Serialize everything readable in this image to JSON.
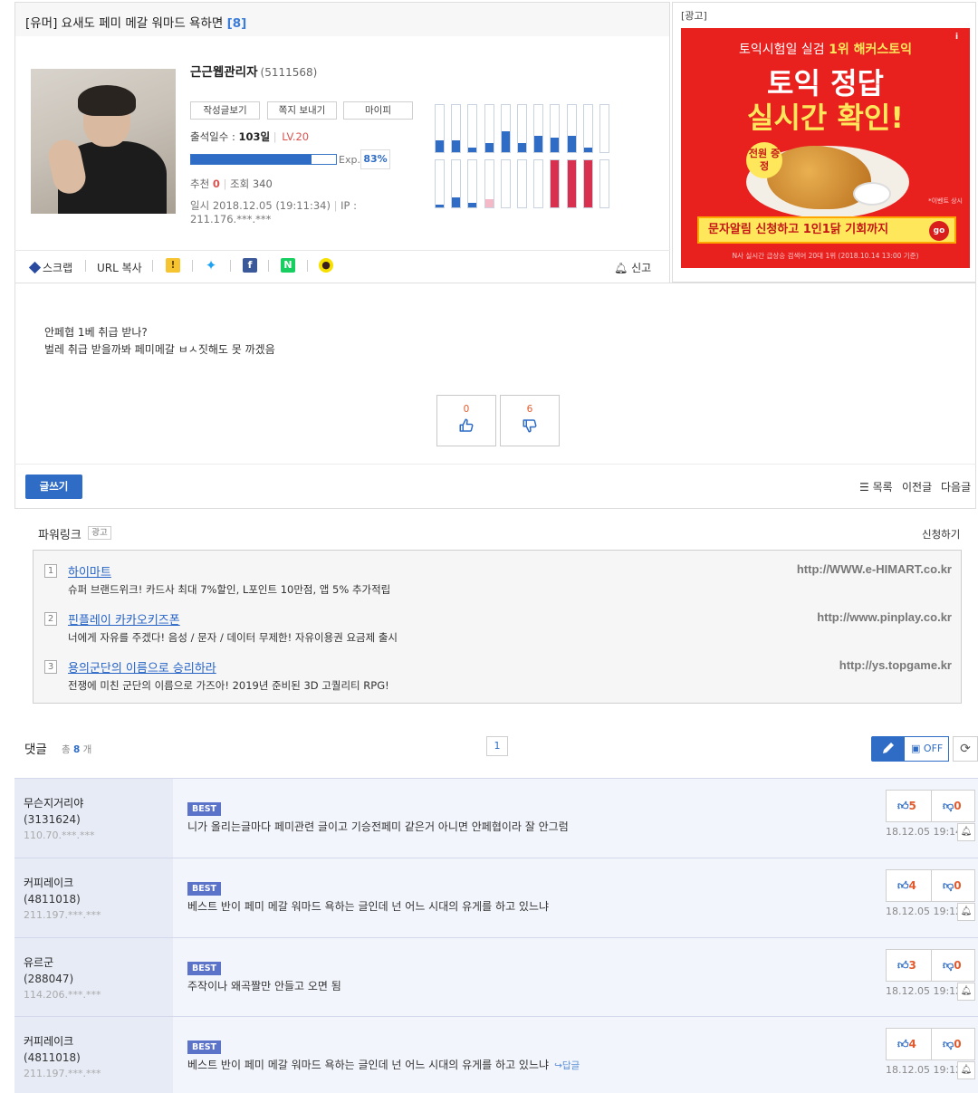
{
  "post": {
    "title": "[유머] 요새도 페미 메갈 워마드 욕하면 ",
    "comment_count_label": "[8]",
    "body_lines": [
      "안페협 1베 취급 받나?",
      "벌레 취급 받을까봐 페미메갈 ㅂㅅ짓해도 못 까겠음"
    ],
    "votes": {
      "up": "0",
      "down": "6"
    }
  },
  "author": {
    "name": "근근웹관리자",
    "id": "(5111568)",
    "buttons": [
      "작성글보기",
      "쪽지 보내기",
      "마이피"
    ],
    "attendance_label": "출석일수 : ",
    "attendance_days": "103일",
    "level": "LV.20",
    "exp_label": "Exp.",
    "exp_percent": "83%",
    "exp_value": 0.83,
    "rec_label": "추천",
    "rec_count": "0",
    "views_label": "조회 340",
    "date_line": "일시 2018.12.05 (19:11:34)",
    "ip_line": "IP : 211.176.***.***",
    "activity_top": [
      0.25,
      0.25,
      0.1,
      0.2,
      0.45,
      0.2,
      0.35,
      0.3,
      0.35,
      0.1,
      0.0
    ],
    "activity_bottom": [
      0.05,
      0.22,
      0.1,
      0.18,
      0.0,
      0.0,
      0.0,
      1.0,
      1.0,
      1.0,
      0.0
    ],
    "activity_bottom_colors": [
      "#2e6cc6",
      "#2e6cc6",
      "#2e6cc6",
      "#f4b8c6",
      "#2e6cc6",
      "#2e6cc6",
      "#2e6cc6",
      "#d9304f",
      "#d9304f",
      "#d9304f",
      "#2e6cc6"
    ]
  },
  "share": {
    "scrap": "스크랩",
    "url_copy": "URL 복사",
    "report": "신고"
  },
  "ad": {
    "label": "[광고]",
    "top_line_1": "토익시험일 실검 ",
    "top_line_2": "1위 해커스토익",
    "headline_1": "토익 정답",
    "headline_2": "실시간 확인!",
    "badge": "전원 증정",
    "small_note": "*이벤트 상시",
    "strip": "문자알림 신청하고 1인1닭 기회까지",
    "go": "go",
    "foot": "N사 실시간 급상승 검색어 20대 1위 (2018.10.14 13:00 기준)"
  },
  "footer": {
    "write": "글쓰기",
    "list": "목록",
    "prev": "이전글",
    "next": "다음글"
  },
  "powerlink": {
    "title": "파워링크",
    "tag": "광고",
    "apply": "신청하기",
    "items": [
      {
        "idx": "1",
        "name": "하이마트",
        "desc": "슈퍼 브랜드위크! 카드사 최대 7%할인, L포인트 10만점, 앱 5% 추가적립",
        "url": "http://WWW.e-HIMART.co.kr"
      },
      {
        "idx": "2",
        "name": "핀플레이 카카오키즈폰",
        "desc": "너에게 자유를 주겠다! 음성 / 문자 / 데이터 무제한! 자유이용권 요금제 출시",
        "url": "http://www.pinplay.co.kr"
      },
      {
        "idx": "3",
        "name": "용의군단의 이름으로 승리하라",
        "desc": "전쟁에 미친 군단의 이름으로 가즈아! 2019년 준비된 3D 고퀄리티 RPG!",
        "url": "http://ys.topgame.kr"
      }
    ]
  },
  "comments": {
    "title": "댓글",
    "total_prefix": "총 ",
    "total_count": "8",
    "total_suffix": " 개",
    "page": "1",
    "image_toggle": "OFF",
    "best_label": "BEST",
    "items": [
      {
        "nick": "무슨지거리야",
        "uid": "(3131624)",
        "ip": "110.70.***.***",
        "text": "니가 올리는글마다 페미관련 글이고 기승전페미 같은거 아니면 안페협이라 잘 안그럼",
        "up": "5",
        "down": "0",
        "date": "18.12.05 19:14",
        "reply": ""
      },
      {
        "nick": "커피레이크",
        "uid": "(4811018)",
        "ip": "211.197.***.***",
        "text": "베스트 반이 페미 메갈 워마드 욕하는 글인데 넌 어느 시대의 유게를 하고 있느냐",
        "up": "4",
        "down": "0",
        "date": "18.12.05 19:12",
        "reply": ""
      },
      {
        "nick": "유르군",
        "uid": "(288047)",
        "ip": "114.206.***.***",
        "text": "주작이나 왜곡짤만 안들고 오면 됨",
        "up": "3",
        "down": "0",
        "date": "18.12.05 19:12",
        "reply": ""
      },
      {
        "nick": "커피레이크",
        "uid": "(4811018)",
        "ip": "211.197.***.***",
        "text": "베스트 반이 페미 메갈 워마드 욕하는 글인데 넌 어느 시대의 유게를 하고 있느냐",
        "up": "4",
        "down": "0",
        "date": "18.12.05 19:12",
        "reply": "답글"
      }
    ]
  }
}
